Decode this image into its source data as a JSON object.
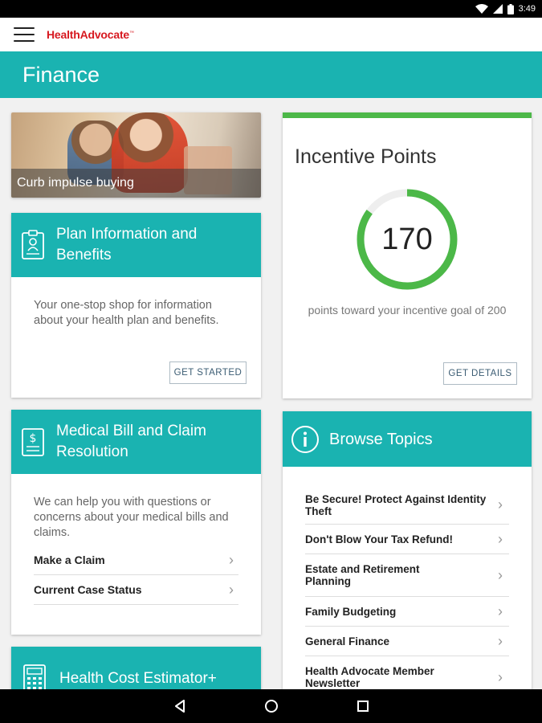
{
  "status": {
    "time": "3:49"
  },
  "app": {
    "logo_text": "HealthAdvocate",
    "logo_mark": "™"
  },
  "page": {
    "title": "Finance"
  },
  "hero": {
    "caption": "Curb impulse buying"
  },
  "plan_card": {
    "title_line1": "Plan Information and",
    "title_line2": "Benefits",
    "description": "Your one-stop shop for information about your health plan and benefits.",
    "button": "GET STARTED"
  },
  "medical_card": {
    "title_line1": "Medical Bill and Claim",
    "title_line2": "Resolution",
    "description": "We can help you with questions or concerns about your medical bills and claims.",
    "links": [
      "Make a Claim",
      "Current Case Status"
    ]
  },
  "estimator_card": {
    "title": "Health Cost Estimator+"
  },
  "incentive": {
    "title": "Incentive Points",
    "points": "170",
    "goal_text": "points toward your incentive goal of 200",
    "points_value": 170,
    "goal_value": 200,
    "button": "GET DETAILS",
    "accent": "#4cb848"
  },
  "topics": {
    "title": "Browse Topics",
    "items": [
      "Be Secure!  Protect Against Identity Theft",
      "Don't Blow Your Tax Refund!",
      "Estate and Retirement Planning",
      "Family Budgeting",
      "General Finance",
      "Health Advocate Member Newsletter"
    ]
  },
  "colors": {
    "teal": "#1ab3b1",
    "brand_red": "#d71920",
    "green": "#4cb848"
  }
}
